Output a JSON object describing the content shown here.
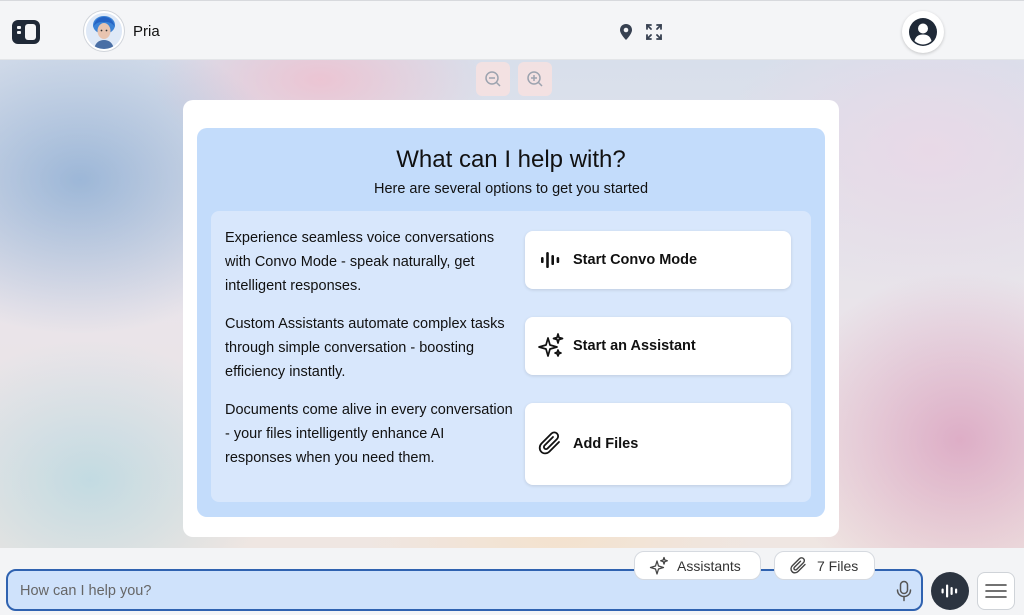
{
  "header": {
    "assistant_name": "Pria",
    "icons": [
      "sidebar-toggle-icon",
      "assistant-avatar",
      "location-pin-icon",
      "fullscreen-icon",
      "user-account-icon"
    ]
  },
  "zoom": {
    "icons": [
      "zoom-out-icon",
      "zoom-in-icon"
    ]
  },
  "help": {
    "title": "What can I help with?",
    "subtitle": "Here are several options to get you started",
    "options": [
      {
        "description": "Experience seamless voice conversations with Convo Mode - speak naturally, get intelligent responses.",
        "button_label": "Start Convo Mode",
        "icon": "voice-wave-icon"
      },
      {
        "description": "Custom Assistants automate complex tasks through simple conversation - boosting efficiency instantly.",
        "button_label": "Start an Assistant",
        "icon": "sparkles-icon"
      },
      {
        "description": "Documents come alive in every conversation - your files intelligently enhance AI responses when you need them.",
        "button_label": "Add Files",
        "icon": "paperclip-icon"
      }
    ]
  },
  "composer": {
    "assistants_chip": "Assistants",
    "files_chip": "7 Files",
    "placeholder": "How can I help you?",
    "icons": [
      "mic-icon",
      "voice-mode-icon",
      "menu-icon"
    ]
  },
  "colors": {
    "card_blue": "#c3dcfb",
    "panel_blue": "#d8e7fc",
    "input_border": "#2f62b0",
    "voice_button": "#2c3440"
  }
}
